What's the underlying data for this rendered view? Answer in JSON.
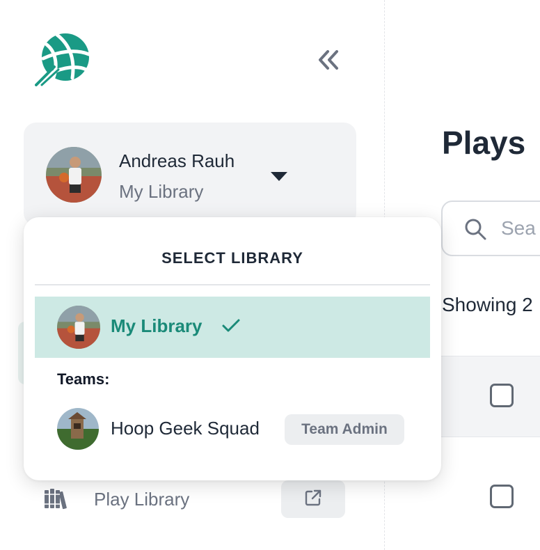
{
  "sidebar": {
    "logo_icon": "basketball-icon",
    "collapse_icon": "double-chevron-left-icon",
    "user": {
      "name": "Andreas Rauh",
      "library": "My Library"
    },
    "nav": [
      {
        "label": "Play Library",
        "icon": "books-icon",
        "action_icon": "external-link-icon"
      }
    ]
  },
  "main": {
    "title": "Plays",
    "search_placeholder": "Sea",
    "showing_text": "Showing 2"
  },
  "dropdown": {
    "title": "SELECT LIBRARY",
    "selected_label": "My Library",
    "teams_heading": "Teams:",
    "teams": [
      {
        "name": "Hoop Geek Squad",
        "role": "Team Admin"
      }
    ]
  },
  "colors": {
    "brand": "#1a9a85",
    "selected_bg": "#cde9e4",
    "selected_text": "#1a8a78"
  }
}
